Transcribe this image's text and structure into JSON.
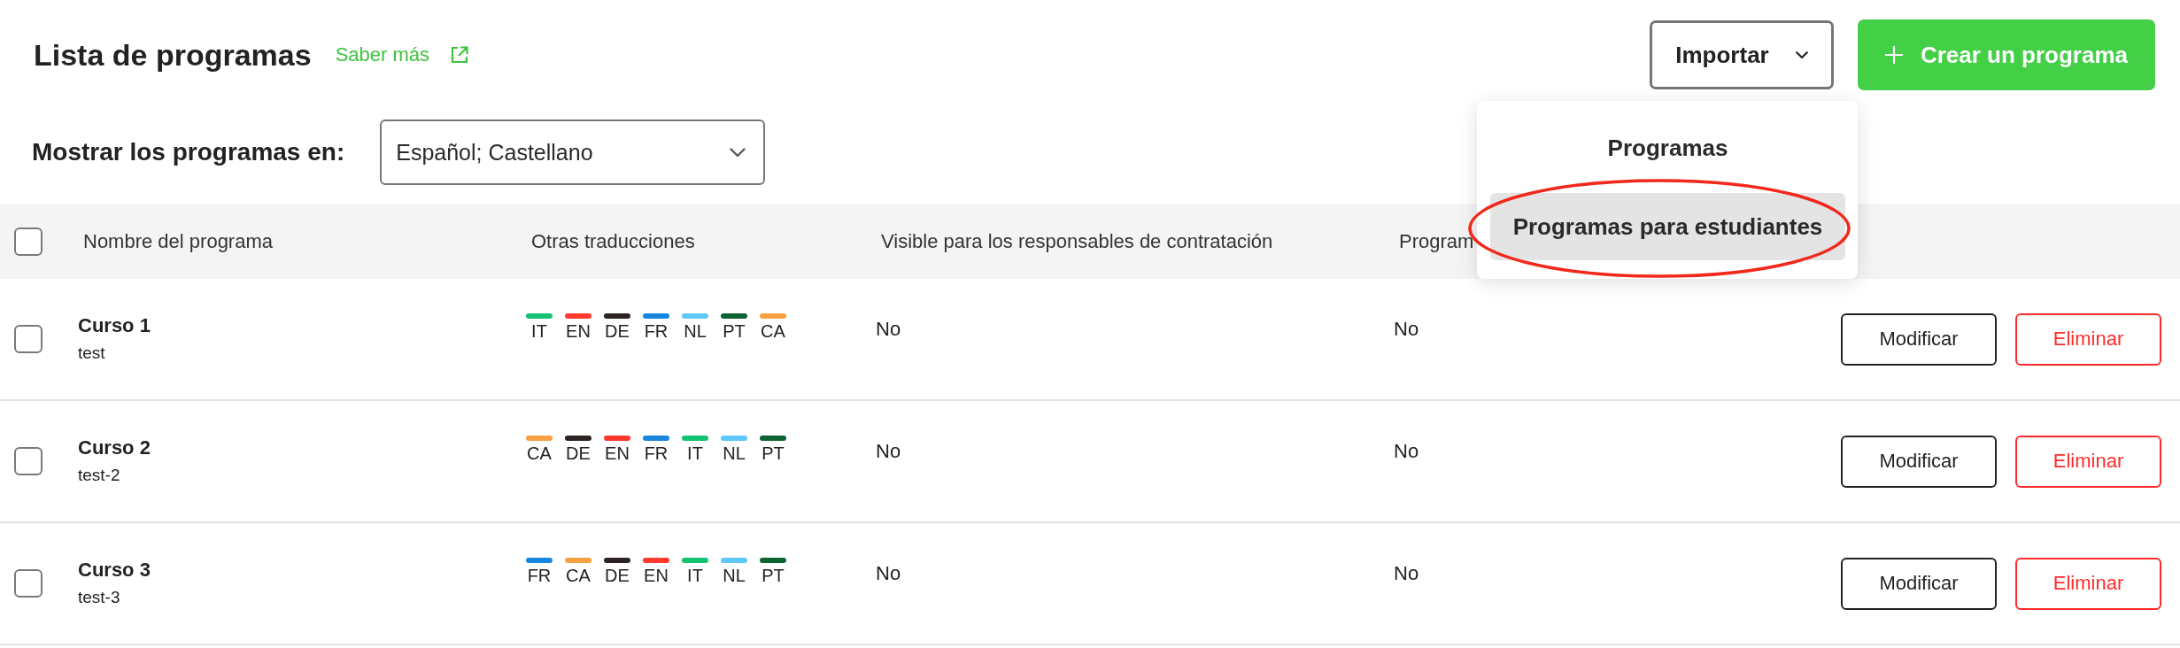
{
  "header": {
    "title": "Lista de programas",
    "help_link": "Saber más"
  },
  "import_button": {
    "label": "Importar",
    "expanded": true
  },
  "import_menu": [
    {
      "label": "Programas",
      "selected": false,
      "circled": false
    },
    {
      "label": "Programas para estudiantes",
      "selected": true,
      "circled": true
    }
  ],
  "create_button": {
    "label": "Crear un programa"
  },
  "language_filter": {
    "label": "Mostrar los programas en:",
    "value": "Español; Castellano"
  },
  "table": {
    "select_all": {
      "checked": false
    },
    "columns": [
      "Nombre del programa",
      "Otras traducciones",
      "Visible para los responsables de contratación",
      "Program"
    ],
    "rows": [
      {
        "checked": false,
        "name": "Curso 1",
        "subtitle": "test",
        "translations": [
          {
            "code": "IT",
            "color": "#14c274"
          },
          {
            "code": "EN",
            "color": "#ff3a2c"
          },
          {
            "code": "DE",
            "color": "#2b2422"
          },
          {
            "code": "FR",
            "color": "#1886de"
          },
          {
            "code": "NL",
            "color": "#5ec8fa"
          },
          {
            "code": "PT",
            "color": "#0c6432"
          },
          {
            "code": "CA",
            "color": "#f7a042"
          }
        ],
        "visible": "No",
        "column_4": "No",
        "actions": [
          {
            "label": "Modificar",
            "kind": "edit"
          },
          {
            "label": "Eliminar",
            "kind": "delete"
          }
        ]
      },
      {
        "checked": false,
        "name": "Curso 2",
        "subtitle": "test-2",
        "translations": [
          {
            "code": "CA",
            "color": "#f7a042"
          },
          {
            "code": "DE",
            "color": "#2b2422"
          },
          {
            "code": "EN",
            "color": "#ff3a2c"
          },
          {
            "code": "FR",
            "color": "#1886de"
          },
          {
            "code": "IT",
            "color": "#14c274"
          },
          {
            "code": "NL",
            "color": "#5ec8fa"
          },
          {
            "code": "PT",
            "color": "#0c6432"
          }
        ],
        "visible": "No",
        "column_4": "No",
        "actions": [
          {
            "label": "Modificar",
            "kind": "edit"
          },
          {
            "label": "Eliminar",
            "kind": "delete"
          }
        ]
      },
      {
        "checked": false,
        "name": "Curso 3",
        "subtitle": "test-3",
        "translations": [
          {
            "code": "FR",
            "color": "#1886de"
          },
          {
            "code": "CA",
            "color": "#f7a042"
          },
          {
            "code": "DE",
            "color": "#2b2422"
          },
          {
            "code": "EN",
            "color": "#ff3a2c"
          },
          {
            "code": "IT",
            "color": "#14c274"
          },
          {
            "code": "NL",
            "color": "#5ec8fa"
          },
          {
            "code": "PT",
            "color": "#0c6432"
          }
        ],
        "visible": "No",
        "column_4": "No",
        "actions": [
          {
            "label": "Modificar",
            "kind": "edit"
          },
          {
            "label": "Eliminar",
            "kind": "delete"
          }
        ]
      }
    ]
  }
}
